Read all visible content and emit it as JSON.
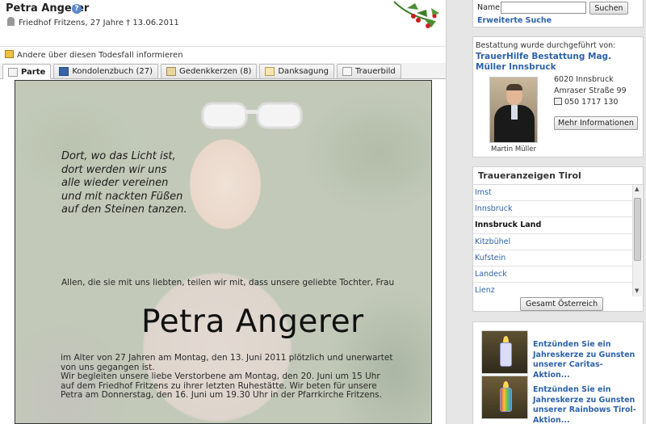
{
  "header": {
    "name": "Petra Angerer",
    "help_icon_glyph": "?",
    "cemetery_line": "Friedhof Fritzens, 27 Jahre † 13.06.2011",
    "inform_link": "Andere über diesen Todesfall informieren"
  },
  "tabs": [
    {
      "label": "Parte",
      "icon": "notice-icon"
    },
    {
      "label": "Kondolenzbuch (27)",
      "icon": "book-icon"
    },
    {
      "label": "Gedenkkerzen (8)",
      "icon": "candle-icon"
    },
    {
      "label": "Danksagung",
      "icon": "thanks-icon"
    },
    {
      "label": "Trauerbild",
      "icon": "picture-icon"
    }
  ],
  "active_tab": "Parte",
  "notice": {
    "poem": [
      "Dort, wo das Licht ist,",
      "dort werden wir uns",
      "alle wieder vereinen",
      "und mit nackten Füßen",
      "auf den Steinen tanzen."
    ],
    "intro": "Allen, die sie mit uns liebten, teilen wir mit, dass unsere geliebte Tochter, Frau",
    "name": "Petra Angerer",
    "body": [
      "im Alter von 27 Jahren am Montag, den 13. Juni 2011 plötzlich und unerwartet",
      "von uns gegangen ist.",
      "Wir begleiten unsere liebe Verstorbene am Montag, den 20. Juni um 15 Uhr",
      "auf dem Friedhof Fritzens zu ihrer letzten Ruhestätte. Wir beten für  unsere",
      "Petra am Donnerstag, den 16. Juni um 19.30 Uhr in der Pfarrkirche Fritzens."
    ]
  },
  "search": {
    "label": "Name:",
    "value": "",
    "button": "Suchen",
    "advanced": "Erweiterte Suche"
  },
  "undertaker": {
    "intro": "Bestattung wurde durchgeführt von:",
    "name": "TrauerHilfe Bestattung Mag. Müller Innsbruck",
    "person": "Martin Müller",
    "city": "6020 Innsbruck",
    "street": "Amraser Straße 99",
    "phone": "050 1717 130",
    "more_button": "Mehr Informationen"
  },
  "regions": {
    "title": "Traueranzeigen Tirol",
    "items": [
      "Imst",
      "Innsbruck",
      "Innsbruck Land",
      "Kitzbühel",
      "Kufstein",
      "Landeck",
      "Lienz"
    ],
    "selected": "Innsbruck Land",
    "all_button": "Gesamt Österreich"
  },
  "candles": [
    {
      "text": "Entzünden Sie ein Jahreskerze zu Gunsten unserer Caritas-Aktion...",
      "thumb_label": "Caritas"
    },
    {
      "text": "Entzünden Sie ein Jahreskerze zu Gunsten unserer Rainbows Tirol-Aktion...",
      "thumb_label": "Rainbows"
    }
  ],
  "colors": {
    "link": "#2e63a8",
    "panel_bg": "#e6e6e6",
    "tab_border": "#b9b9b9"
  }
}
